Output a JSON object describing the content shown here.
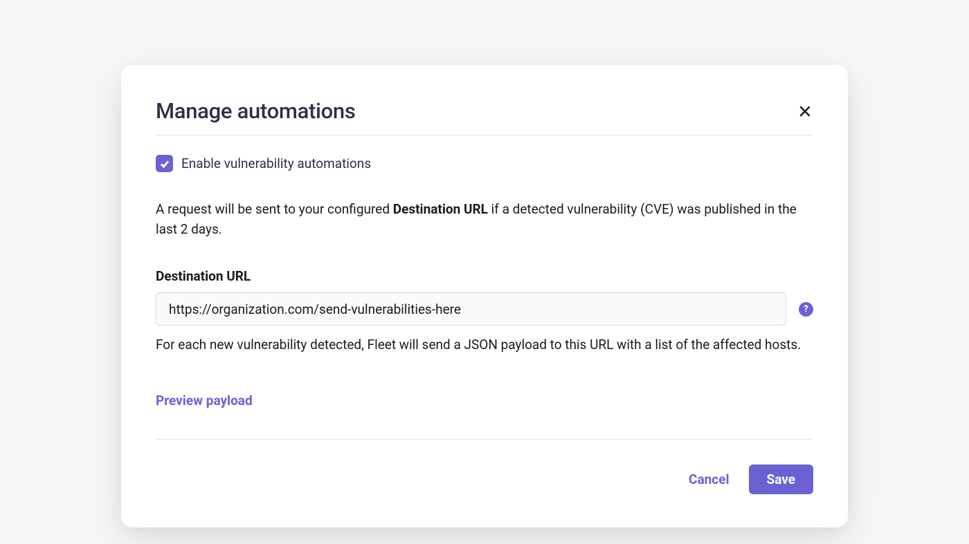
{
  "modal": {
    "title": "Manage automations",
    "checkbox_label": "Enable vulnerability automations",
    "checkbox_checked": true,
    "description_pre": "A request will be sent to your configured ",
    "description_bold": "Destination URL",
    "description_post": " if a detected vulnerability (CVE) was published in the last 2 days.",
    "field_label": "Destination URL",
    "field_value": "https://organization.com/send-vulnerabilities-here",
    "helper_text": "For each new vulnerability detected, Fleet will send a JSON payload to this URL with a list of the affected hosts.",
    "preview_link": "Preview payload",
    "cancel_label": "Cancel",
    "save_label": "Save",
    "help_icon_label": "?"
  }
}
